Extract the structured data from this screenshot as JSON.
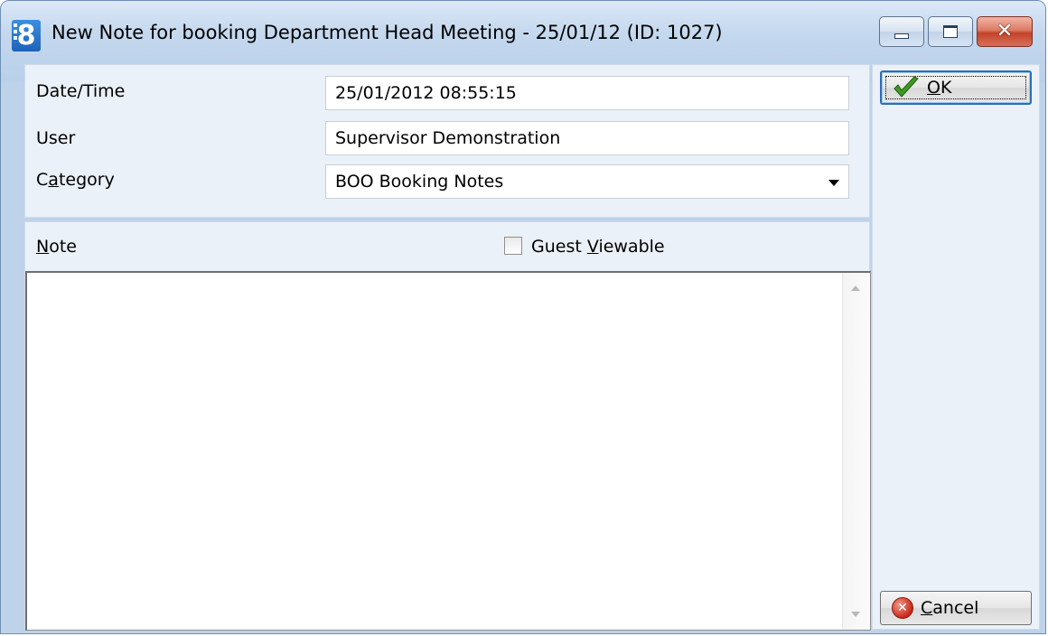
{
  "window": {
    "title": "New Note for booking Department Head Meeting - 25/01/12 (ID: 1027)",
    "icon_char": "8",
    "controls": [
      "minimize-icon",
      "maximize-icon",
      "close-icon"
    ]
  },
  "form": {
    "datetime_label": "Date/Time",
    "datetime_value": "25/01/2012 08:55:15",
    "user_label": "User",
    "user_value": "Supervisor Demonstration",
    "category_label_pre": "C",
    "category_label_ul": "a",
    "category_label_post": "tegory",
    "category_value": "BOO Booking Notes"
  },
  "note": {
    "label_ul": "N",
    "label_post": "ote",
    "guest_viewable_pre": "Guest ",
    "guest_viewable_ul": "V",
    "guest_viewable_post": "iewable",
    "guest_viewable_checked": false,
    "text": ""
  },
  "buttons": {
    "ok_ul": "O",
    "ok_post": "K",
    "cancel_ul": "C",
    "cancel_post": "ancel"
  },
  "colors": {
    "window_bg": "#bed3ea",
    "panel_bg": "#ebf1f8",
    "focus_border": "#2d6fb1"
  }
}
